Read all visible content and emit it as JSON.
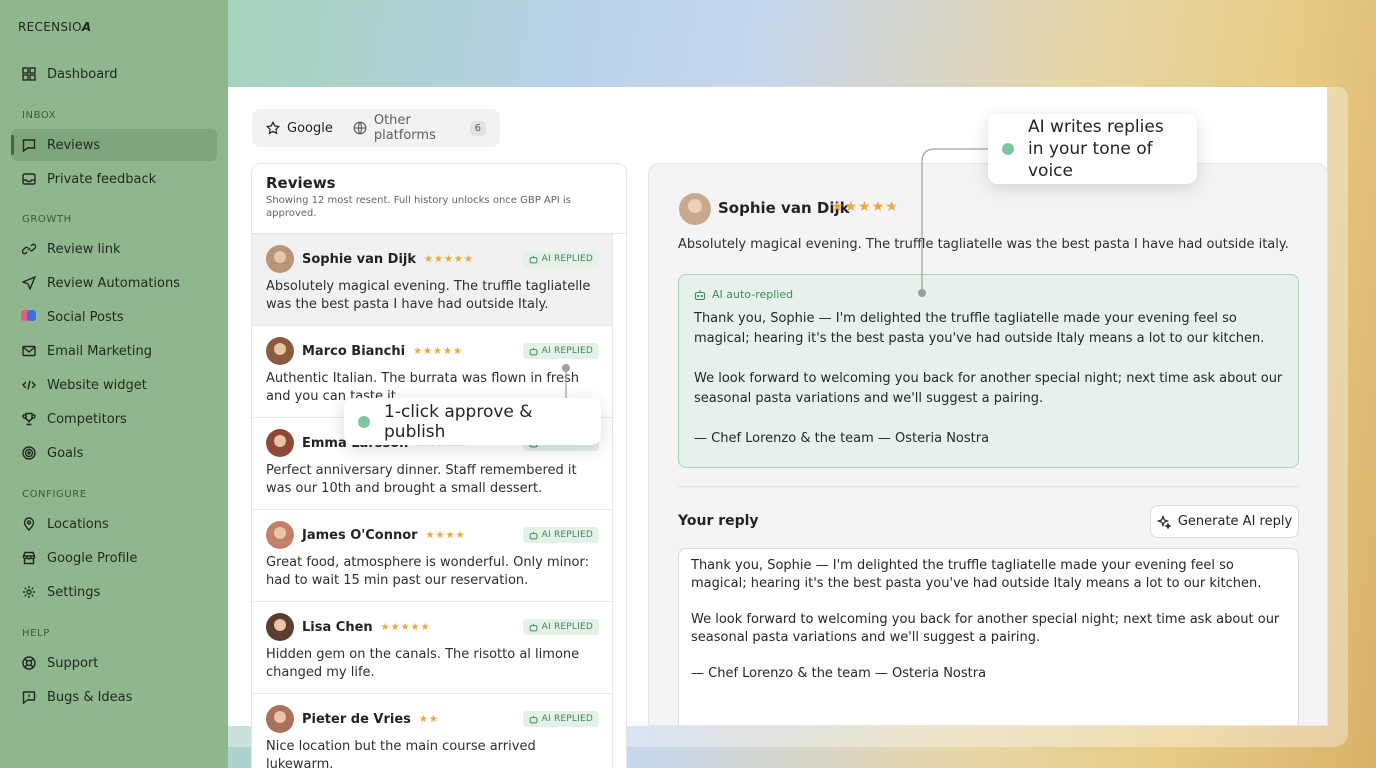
{
  "app": {
    "logo": "RECENSIO",
    "logo_mark": "A"
  },
  "sidebar": {
    "dashboard": "Dashboard",
    "sections": {
      "inbox": "INBOX",
      "growth": "GROWTH",
      "configure": "CONFIGURE",
      "help": "HELP"
    },
    "inbox": [
      "Reviews",
      "Private feedback"
    ],
    "growth": [
      "Review link",
      "Review Automations",
      "Social Posts",
      "Email Marketing",
      "Website widget",
      "Competitors",
      "Goals"
    ],
    "configure": [
      "Locations",
      "Google Profile",
      "Settings"
    ],
    "help": [
      "Support",
      "Bugs & Ideas"
    ]
  },
  "tabs": {
    "google": "Google",
    "other": "Other platforms",
    "other_count": "6"
  },
  "list": {
    "title": "Reviews",
    "subtitle": "Showing 12 most resent. Full history unlocks once GBP API is approved.",
    "badge": "AI REPLIED",
    "items": [
      {
        "name": "Sophie van Dijk",
        "stars": "★★★★★",
        "text": "Absolutely magical evening. The truffle tagliatelle was the best pasta I have had outside Italy.",
        "avatar_color": "#b89478"
      },
      {
        "name": "Marco Bianchi",
        "stars": "★★★★★",
        "text": "Authentic Italian. The burrata was flown in fresh and you can taste it.",
        "avatar_color": "#8a5a3c"
      },
      {
        "name": "Emma Larsson",
        "stars": "★★★★★",
        "text": "Perfect anniversary dinner. Staff remembered it was our 10th and brought a small dessert.",
        "avatar_color": "#8c4b36"
      },
      {
        "name": "James O'Connor",
        "stars": "★★★★",
        "text": "Great food, atmosphere is wonderful. Only minor: had to wait 15 min past our reservation.",
        "avatar_color": "#c0806a"
      },
      {
        "name": "Lisa Chen",
        "stars": "★★★★★",
        "text": "Hidden gem on the canals. The risotto al limone changed my life.",
        "avatar_color": "#5a3d2e"
      },
      {
        "name": "Pieter de Vries",
        "stars": "★★",
        "text": "Nice location but the main course arrived lukewarm.",
        "avatar_color": "#a8735a"
      }
    ]
  },
  "detail": {
    "name": "Sophie van Dijk",
    "stars": "★★★★★",
    "text": "Absolutely magical evening. The truffle tagliatelle was the best pasta I have had outside italy.",
    "ai_label": "AI auto-replied",
    "ai_p1": "Thank you, Sophie — I'm delighted the truffle tagliatelle made your evening feel so magical; hearing it's the best pasta you've had outside Italy means a lot to our kitchen.",
    "ai_p2": "We look forward to welcoming you back for another special night; next time ask about our seasonal pasta variations and we'll suggest a pairing.",
    "ai_p3": "— Chef Lorenzo & the team — Osteria Nostra",
    "your_reply": "Your reply",
    "generate": "Generate AI reply",
    "reply_p1": "Thank you, Sophie — I'm delighted the truffle tagliatelle made your evening feel so magical; hearing it's the best pasta you've had outside Italy means a lot to our kitchen.",
    "reply_p2": "We look forward to welcoming you back for another special night; next time ask about our seasonal pasta variations and we'll suggest a pairing.",
    "reply_p3": "— Chef Lorenzo & the team — Osteria Nostra"
  },
  "callouts": {
    "ai_writes": "AI writes replies in your tone of voice",
    "approve": "1-click approve & publish"
  },
  "colors": {
    "sidebar": "#8fb68d",
    "accent_green": "#3f8a5a",
    "star": "#f0a733",
    "ai_box": "#e5f1ea"
  }
}
